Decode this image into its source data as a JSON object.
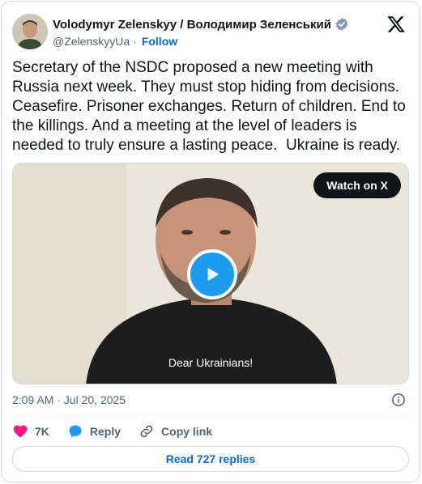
{
  "author": {
    "name": "Volodymyr Zelenskyy / Володимир Зеленський",
    "handle": "@ZelenskyyUa",
    "separator": "·",
    "follow_label": "Follow"
  },
  "tweet": {
    "text": "Secretary of the NSDC proposed a new meeting with Russia next week. They must stop hiding from decisions. Ceasefire. Prisoner exchanges. Return of children. End to the killings. And a meeting at the level of leaders is needed to truly ensure a lasting peace.  Ukraine is ready."
  },
  "media": {
    "watch_label": "Watch on X",
    "subtitle": "Dear Ukrainians!"
  },
  "meta": {
    "timestamp": "2:09 AM · Jul 20, 2025"
  },
  "actions": {
    "likes": "7K",
    "reply_label": "Reply",
    "copy_link_label": "Copy link"
  },
  "replies_button": "Read 727 replies",
  "colors": {
    "accent": "#1d9bf0",
    "link": "#006fd6",
    "like": "#f91880",
    "text": "#0f1419",
    "muted": "#536471"
  }
}
